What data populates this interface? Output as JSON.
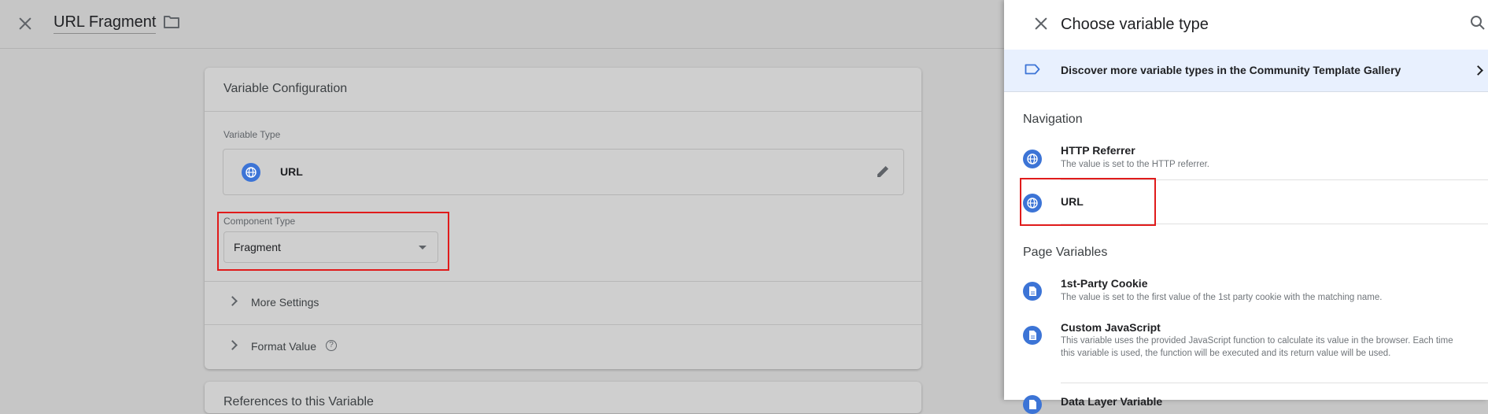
{
  "editor": {
    "title": "URL Fragment",
    "card_header": "Variable Configuration",
    "variable_type_label": "Variable Type",
    "variable_type_value": "URL",
    "component_type_label": "Component Type",
    "component_type_value": "Fragment",
    "more_settings": "More Settings",
    "format_value": "Format Value",
    "help_glyph": "?",
    "next_card_title": "References to this Variable"
  },
  "panel": {
    "title": "Choose variable type",
    "gallery_text": "Discover more variable types in the Community Template Gallery",
    "sections": {
      "navigation": "Navigation",
      "page_variables": "Page Variables"
    },
    "items": [
      {
        "name": "HTTP Referrer",
        "desc": "The value is set to the HTTP referrer.",
        "icon": "globe-icon"
      },
      {
        "name": "URL",
        "desc": "",
        "icon": "globe-icon"
      },
      {
        "name": "1st-Party Cookie",
        "desc": "The value is set to the first value of the 1st party cookie with the matching name.",
        "icon": "document-icon"
      },
      {
        "name": "Custom JavaScript",
        "desc": "This variable uses the provided JavaScript function to calculate its value in the browser. Each time this variable is used, the function will be executed and its return value will be used.",
        "icon": "document-icon"
      },
      {
        "name": "Data Layer Variable",
        "desc": "",
        "icon": "document-icon"
      }
    ]
  },
  "colors": {
    "accent": "#3c74d6",
    "highlight": "#e01b1b",
    "gallery_bg": "#e8f0fe"
  }
}
